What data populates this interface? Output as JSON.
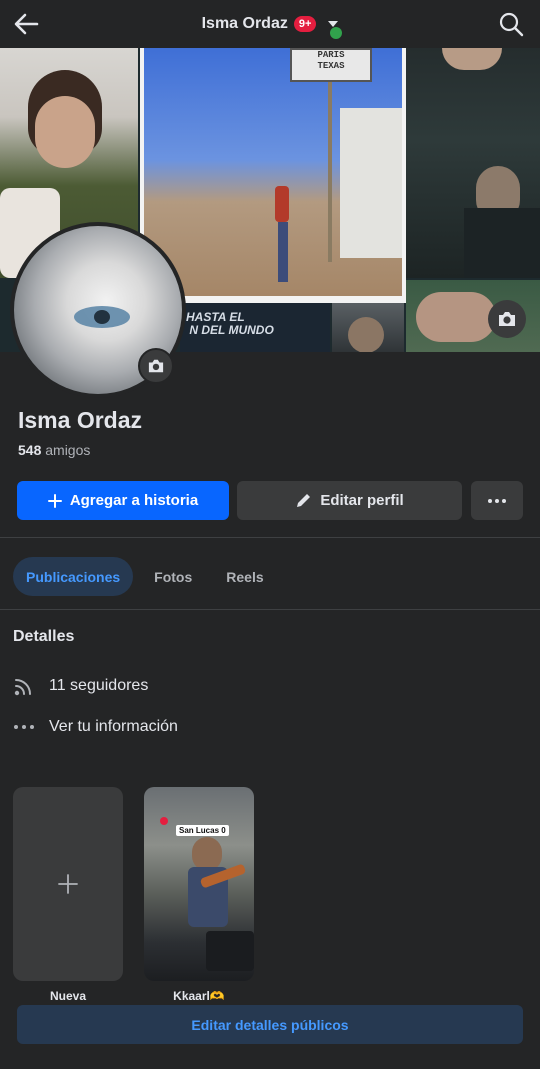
{
  "header": {
    "title": "Isma Ordaz",
    "notif_badge": "9+"
  },
  "cover": {
    "sign_top": "PARIS\nTEXAS",
    "banner_text": "HASTA EL\n N DEL MUNDO"
  },
  "profile": {
    "name": "Isma Ordaz",
    "friends_count": "548",
    "friends_label": "amigos"
  },
  "actions": {
    "add_story": "Agregar a historia",
    "edit_profile": "Editar perfil"
  },
  "tabs": [
    {
      "label": "Publicaciones"
    },
    {
      "label": "Fotos"
    },
    {
      "label": "Reels"
    }
  ],
  "details": {
    "title": "Detalles",
    "followers": "11 seguidores",
    "info": "Ver tu información"
  },
  "stories": {
    "new_label": "Nueva",
    "story_label": "Kkaarl🫶",
    "story_sticker": "San Lucas 0"
  },
  "edit_details_button": "Editar detalles públicos",
  "colors": {
    "background": "#242526",
    "primary": "#0866ff",
    "tab_active_bg": "#263951",
    "tab_active_text": "#4599ff",
    "badge": "#e41e3f",
    "online": "#31a24c"
  }
}
